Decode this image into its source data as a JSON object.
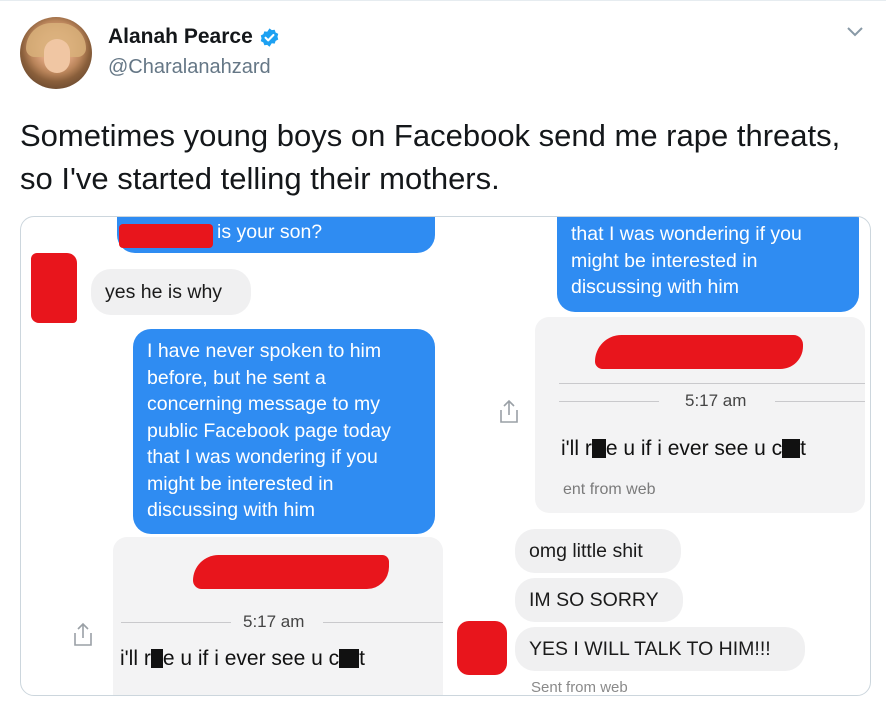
{
  "author": {
    "name": "Alanah Pearce",
    "handle": "@Charalanahzard",
    "verified": true,
    "verified_color": "#1da1f2"
  },
  "tweet": {
    "text": "Sometimes young boys on Facebook send me rape threats, so I've started telling their mothers."
  },
  "screenshot_left": {
    "q1": "is your son?",
    "a1": "yes he is why",
    "msg_lines": [
      "I have never spoken to him",
      "before, but he sent a",
      "concerning message to my",
      "public Facebook page today",
      "that I was wondering if you",
      "might be interested in",
      "discussing with him"
    ],
    "card_time": "5:17 am",
    "card_msg_a": "i'll r",
    "card_msg_b": "e u if i ever see u c",
    "card_msg_c": "t"
  },
  "screenshot_right": {
    "msg_lines": [
      "that I was wondering if you",
      "might be interested in",
      "discussing with him"
    ],
    "card_time": "5:17 am",
    "card_msg_a": "i'll r",
    "card_msg_b": "e u if i ever see u c",
    "card_msg_c": "t",
    "card_from": "ent from web",
    "replies": [
      "omg little shit",
      "IM SO SORRY",
      "YES I WILL TALK TO HIM!!!"
    ],
    "sent_from": "Sent from web"
  },
  "colors": {
    "messenger_blue": "#2f8cf2",
    "redaction_red": "#e8151c"
  },
  "icons": {
    "verified": "verified-badge-icon",
    "caret": "chevron-down-icon",
    "share": "share-icon"
  }
}
